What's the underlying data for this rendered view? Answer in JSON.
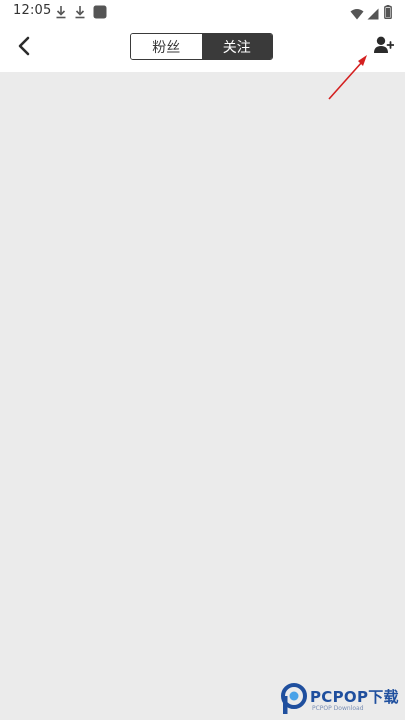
{
  "status_bar": {
    "time": "12:05",
    "icons": [
      "download-icon",
      "download-icon",
      "app-square-icon",
      "wifi-icon",
      "signal-icon",
      "battery-icon"
    ]
  },
  "nav": {
    "back_icon": "chevron-left-icon",
    "tabs": [
      {
        "label": "粉丝",
        "active": false
      },
      {
        "label": "关注",
        "active": true
      }
    ],
    "add_friend_icon": "add-user-icon"
  },
  "colors": {
    "accent": "#3a3a3a",
    "content_bg": "#ebebeb",
    "annotation_arrow": "#d42020",
    "watermark": "#1f4f9e"
  },
  "watermark": {
    "brand": "PCPOP下载",
    "sub": "PCPOP Download"
  }
}
